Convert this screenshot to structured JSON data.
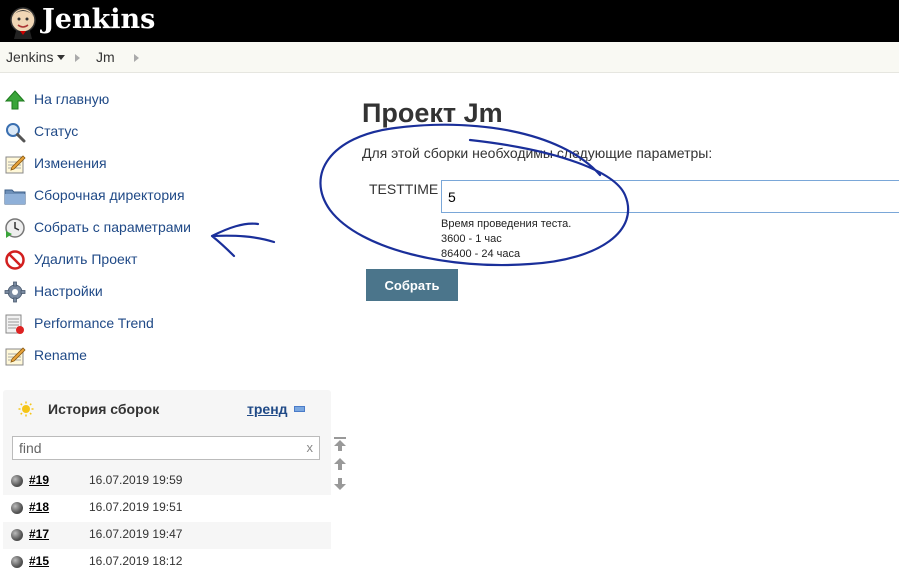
{
  "header": {
    "logo_text": "Jenkins"
  },
  "breadcrumbs": [
    "Jenkins",
    "Jm"
  ],
  "sidebar": {
    "items": [
      {
        "label": "На главную",
        "icon": "up-arrow-icon"
      },
      {
        "label": "Статус",
        "icon": "magnifier-icon"
      },
      {
        "label": "Изменения",
        "icon": "notepad-icon"
      },
      {
        "label": "Сборочная директория",
        "icon": "folder-icon"
      },
      {
        "label": "Собрать с параметрами",
        "icon": "clock-play-icon"
      },
      {
        "label": "Удалить Проект",
        "icon": "no-entry-icon"
      },
      {
        "label": "Настройки",
        "icon": "gear-icon"
      },
      {
        "label": "Performance Trend",
        "icon": "chart-icon"
      },
      {
        "label": "Rename",
        "icon": "notepad-icon"
      }
    ]
  },
  "history": {
    "title": "История сборок",
    "trend_label": "тренд",
    "find_placeholder": "find",
    "find_clear": "x",
    "builds": [
      {
        "number": "#19",
        "date": "16.07.2019 19:59"
      },
      {
        "number": "#18",
        "date": "16.07.2019 19:51"
      },
      {
        "number": "#17",
        "date": "16.07.2019 19:47"
      },
      {
        "number": "#15",
        "date": "16.07.2019 18:12"
      }
    ]
  },
  "main": {
    "title": "Проект Jm",
    "description": "Для этой сборки необходимы следующие параметры:",
    "param": {
      "name": "TESTTIME",
      "value": "5",
      "help": [
        "Время проведения теста.",
        "3600 - 1 час",
        "86400 - 24 часа"
      ]
    },
    "build_button": "Собрать"
  },
  "colors": {
    "header_bg": "#000000",
    "link": "#204a87",
    "button_bg": "#4b758b",
    "annotation_ink": "#1a2f9a"
  }
}
